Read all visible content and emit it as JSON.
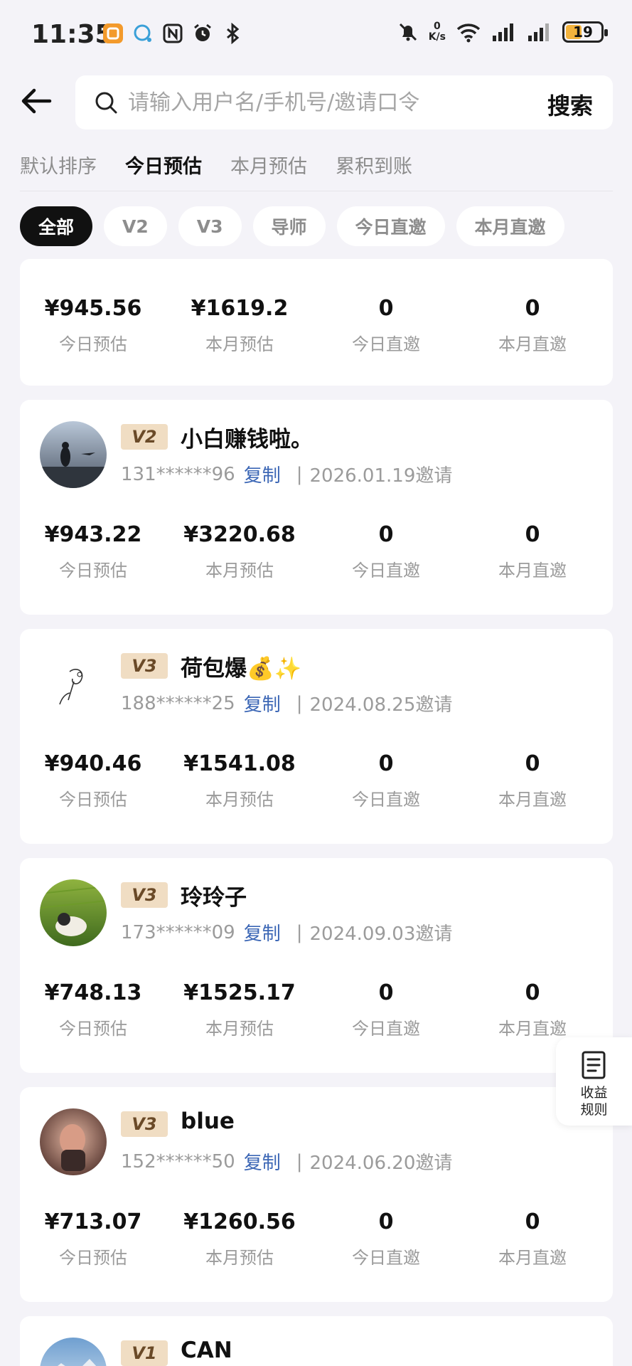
{
  "status_bar": {
    "time": "11:35",
    "speed_top": "0",
    "speed_bottom": "K/s",
    "battery": "19",
    "icons": [
      "app-badge-icon",
      "chat-icon",
      "nfc-icon",
      "alarm-icon",
      "bluetooth-icon",
      "mute-bell-icon",
      "wifi-icon",
      "signal-icon",
      "signal-icon",
      "battery-icon"
    ]
  },
  "search": {
    "placeholder": "请输入用户名/手机号/邀请口令",
    "button_label": "搜索"
  },
  "sort_tabs": [
    {
      "label": "默认排序",
      "active": false
    },
    {
      "label": "今日预估",
      "active": true
    },
    {
      "label": "本月预估",
      "active": false
    },
    {
      "label": "累积到账",
      "active": false
    }
  ],
  "filter_chips": [
    {
      "label": "全部",
      "active": true
    },
    {
      "label": "V2",
      "active": false
    },
    {
      "label": "V3",
      "active": false
    },
    {
      "label": "导师",
      "active": false
    },
    {
      "label": "今日直邀",
      "active": false
    },
    {
      "label": "本月直邀",
      "active": false
    }
  ],
  "stat_labels": [
    "今日预估",
    "本月预估",
    "今日直邀",
    "本月直邀"
  ],
  "copy_label": "复制",
  "members": [
    {
      "name": "",
      "level": "",
      "phone": "",
      "invite_date": "",
      "stats": [
        "¥945.56",
        "¥1619.2",
        "0",
        "0"
      ]
    },
    {
      "name": "小白赚钱啦。",
      "level": "V2",
      "phone": "131******96",
      "invite_date": "2026.01.19邀请",
      "stats": [
        "¥943.22",
        "¥3220.68",
        "0",
        "0"
      ]
    },
    {
      "name": "荷包爆💰✨",
      "level": "V3",
      "phone": "188******25",
      "invite_date": "2024.08.25邀请",
      "stats": [
        "¥940.46",
        "¥1541.08",
        "0",
        "0"
      ]
    },
    {
      "name": "玲玲子",
      "level": "V3",
      "phone": "173******09",
      "invite_date": "2024.09.03邀请",
      "stats": [
        "¥748.13",
        "¥1525.17",
        "0",
        "0"
      ]
    },
    {
      "name": "blue",
      "level": "V3",
      "phone": "152******50",
      "invite_date": "2024.06.20邀请",
      "stats": [
        "¥713.07",
        "¥1260.56",
        "0",
        "0"
      ]
    },
    {
      "name": "CAN",
      "level": "V1",
      "phone": "",
      "invite_date": "",
      "stats": []
    }
  ],
  "rules_button": {
    "line1": "收益",
    "line2": "规则"
  },
  "colors": {
    "background": "#f4f3f8",
    "level_badge_bg": "#f0ddc3",
    "link_blue": "#3b66b5",
    "chip_active": "#111111"
  }
}
